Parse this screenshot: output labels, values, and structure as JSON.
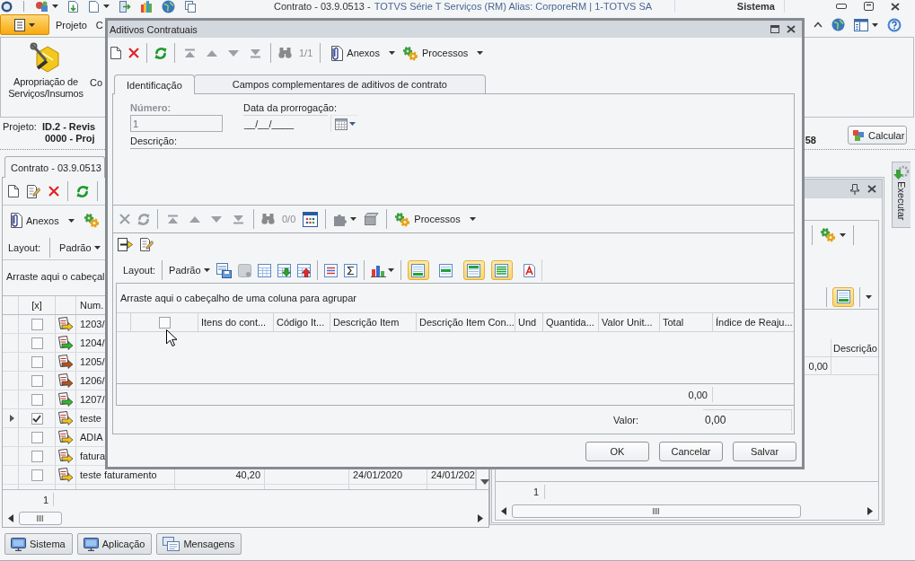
{
  "window": {
    "document_title": "Contrato - 03.9.0513 -",
    "app_title": "TOTVS Série T Serviços (RM) Alias: CorporeRM | 1-TOTVS SA",
    "context": "Sistema"
  },
  "ribbon": {
    "tabs": [
      "Projeto",
      "C"
    ],
    "buttons": [
      "Apropriação de Serviços/Insumos",
      "Co"
    ]
  },
  "project": {
    "label": "Projeto:",
    "lines": [
      "ID.2 - Revis",
      "0000 - Proj"
    ],
    "trailing": "58",
    "calculate_button": "Calcular"
  },
  "contract_panel": {
    "tab": "Contrato - 03.9.0513",
    "attachments": "Anexos",
    "layout_label": "Layout:",
    "layout": "Padrão",
    "group_hint": "Arraste aqui o cabeçal",
    "columns": [
      "[x]",
      "Num."
    ],
    "rows": [
      {
        "selected": false,
        "checked": false,
        "num": "1203/"
      },
      {
        "selected": false,
        "checked": false,
        "num": "1204/"
      },
      {
        "selected": false,
        "checked": false,
        "num": "1205/"
      },
      {
        "selected": false,
        "checked": false,
        "num": "1206/"
      },
      {
        "selected": false,
        "checked": false,
        "num": "1207/"
      },
      {
        "selected": true,
        "checked": true,
        "num": "teste"
      },
      {
        "selected": false,
        "checked": false,
        "num": "ADIA"
      },
      {
        "selected": false,
        "checked": false,
        "num": "fatura"
      },
      {
        "selected": false,
        "checked": false,
        "num": "teste faturamento",
        "column_4": "40,20",
        "column_6": "24/01/2020",
        "column_7": "24/01/202"
      }
    ],
    "footer_count": "1"
  },
  "detail_panel": {
    "view_toggles": [
      {
        "on": true
      }
    ],
    "column_header": "Descrição",
    "cell": "0,00",
    "footer_count": "1"
  },
  "side_tabs": [
    "Executar"
  ],
  "taskbar": [
    "Sistema",
    "Aplicação",
    "Mensagens"
  ],
  "dialog": {
    "title": "Aditivos Contratuais",
    "toolbar": {
      "counter": "1/1",
      "attachments": "Anexos",
      "processes": "Processos"
    },
    "tabs": [
      {
        "label": "Identificação",
        "selected": true
      },
      {
        "label": "Campos complementares de aditivos de contrato",
        "selected": false
      }
    ],
    "form": {
      "number": {
        "label": "Número:",
        "value": "1",
        "disabled": true
      },
      "extension_date": {
        "label": "Data da prorrogação:",
        "value": "__/__/____"
      },
      "description": {
        "label": "Descrição:"
      }
    },
    "items_toolbar": {
      "counter": "0/0",
      "processes": "Processos"
    },
    "layout_bar": {
      "label": "Layout:",
      "layout": "Padrão",
      "view_toggles": [
        {
          "on": true
        },
        {
          "on": false
        },
        {
          "on": true
        },
        {
          "on": true
        },
        {
          "on": false
        }
      ]
    },
    "grid": {
      "group_hint": "Arraste aqui o cabeçalho de uma coluna para agrupar",
      "select_all_checked": false,
      "columns": [
        "Itens do cont...",
        "Código It...",
        "Descrição Item",
        "Descrição Item Con...",
        "Und",
        "Quantida...",
        "Valor Unit...",
        "Total",
        "Índice de Reaju..."
      ],
      "footer_total": "0,00"
    },
    "total": {
      "label": "Valor:",
      "value": "0,00"
    },
    "buttons": [
      "OK",
      "Cancelar",
      "Salvar"
    ]
  }
}
